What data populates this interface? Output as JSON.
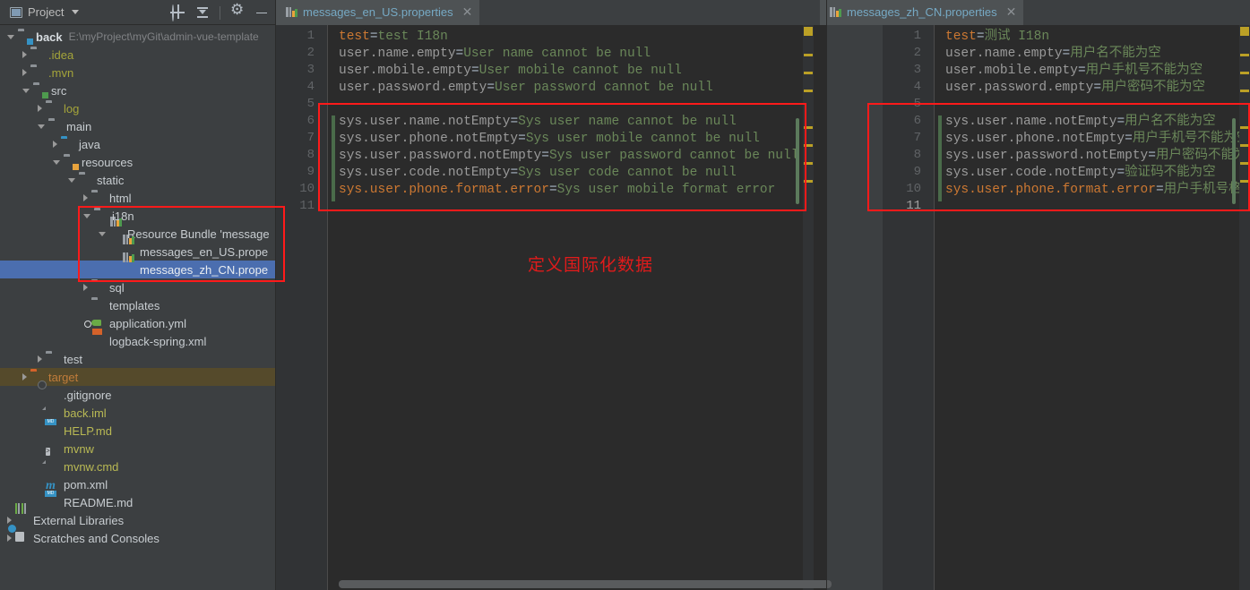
{
  "project_panel": {
    "title": "Project",
    "title_icon": "project-window-icon",
    "dropdown_icon": "chevron-down-icon",
    "tools": [
      {
        "name": "locate-icon",
        "label": "Select Opened File"
      },
      {
        "name": "collapse-all-icon",
        "label": "Collapse All"
      },
      {
        "name": "gear-icon",
        "label": "Settings"
      },
      {
        "name": "minimize-icon",
        "label": "Hide"
      }
    ],
    "tree": [
      {
        "indent": 0,
        "arrow": "open",
        "icon": "module-folder-icon",
        "label": "back",
        "style": "bold",
        "suffix": "E:\\myProject\\myGit\\admin-vue-template"
      },
      {
        "indent": 1,
        "arrow": "closed",
        "icon": "folder-icon",
        "label": ".idea",
        "style": "yellow"
      },
      {
        "indent": 1,
        "arrow": "closed",
        "icon": "folder-icon",
        "label": ".mvn",
        "style": "yellow"
      },
      {
        "indent": 1,
        "arrow": "open",
        "icon": "source-folder-icon",
        "label": "src",
        "style": "white"
      },
      {
        "indent": 2,
        "arrow": "closed",
        "icon": "folder-icon",
        "label": "log",
        "style": "yellow"
      },
      {
        "indent": 2,
        "arrow": "open",
        "icon": "folder-icon",
        "label": "main",
        "style": "white"
      },
      {
        "indent": 3,
        "arrow": "closed",
        "icon": "java-source-folder-icon",
        "label": "java",
        "style": "white"
      },
      {
        "indent": 3,
        "arrow": "open",
        "icon": "resources-folder-icon",
        "label": "resources",
        "style": "white"
      },
      {
        "indent": 4,
        "arrow": "open",
        "icon": "folder-icon",
        "label": "static",
        "style": "white"
      },
      {
        "indent": 5,
        "arrow": "closed",
        "icon": "folder-icon",
        "label": "html",
        "style": "white"
      },
      {
        "indent": 5,
        "arrow": "open",
        "icon": "folder-icon",
        "label": "i18n",
        "style": "white"
      },
      {
        "indent": 6,
        "arrow": "open",
        "icon": "resource-bundle-icon",
        "label": "Resource Bundle 'message",
        "style": "white"
      },
      {
        "indent": 7,
        "arrow": "none",
        "icon": "properties-file-icon",
        "label": "messages_en_US.prope",
        "style": "white"
      },
      {
        "indent": 7,
        "arrow": "none",
        "icon": "properties-file-icon",
        "label": "messages_zh_CN.prope",
        "style": "selected",
        "selected": true
      },
      {
        "indent": 5,
        "arrow": "closed",
        "icon": "folder-icon",
        "label": "sql",
        "style": "white"
      },
      {
        "indent": 5,
        "arrow": "none",
        "icon": "folder-icon",
        "label": "templates",
        "style": "white"
      },
      {
        "indent": 5,
        "arrow": "none",
        "icon": "yaml-file-icon",
        "label": "application.yml",
        "style": "white"
      },
      {
        "indent": 5,
        "arrow": "none",
        "icon": "xml-file-icon",
        "label": "logback-spring.xml",
        "style": "white"
      },
      {
        "indent": 2,
        "arrow": "closed",
        "icon": "folder-icon",
        "label": "test",
        "style": "white"
      },
      {
        "indent": 1,
        "arrow": "closed",
        "icon": "target-folder-icon",
        "label": "target",
        "style": "orange",
        "highlight": "target"
      },
      {
        "indent": 2,
        "arrow": "none",
        "icon": "gitignore-file-icon",
        "label": ".gitignore",
        "style": "white"
      },
      {
        "indent": 2,
        "arrow": "none",
        "icon": "iml-file-icon",
        "label": "back.iml",
        "style": "olive"
      },
      {
        "indent": 2,
        "arrow": "none",
        "icon": "markdown-file-icon",
        "label": "HELP.md",
        "style": "olive"
      },
      {
        "indent": 2,
        "arrow": "none",
        "icon": "shell-file-icon",
        "label": "mvnw",
        "style": "olive"
      },
      {
        "indent": 2,
        "arrow": "none",
        "icon": "cmd-file-icon",
        "label": "mvnw.cmd",
        "style": "olive"
      },
      {
        "indent": 2,
        "arrow": "none",
        "icon": "maven-file-icon",
        "label": "pom.xml",
        "style": "white"
      },
      {
        "indent": 2,
        "arrow": "none",
        "icon": "markdown-file-icon",
        "label": "README.md",
        "style": "white"
      },
      {
        "indent": 0,
        "arrow": "closed",
        "icon": "external-libraries-icon",
        "label": "External Libraries",
        "style": "white"
      },
      {
        "indent": 0,
        "arrow": "closed",
        "icon": "scratches-icon",
        "label": "Scratches and Consoles",
        "style": "white"
      }
    ]
  },
  "editors": {
    "left_tab": {
      "label": "messages_en_US.properties",
      "icon": "properties-file-icon",
      "close_icon": "close-icon"
    },
    "right_tab": {
      "label": "messages_zh_CN.properties",
      "icon": "properties-file-icon",
      "close_icon": "close-icon"
    },
    "left_file": {
      "line_numbers": [
        "1",
        "2",
        "3",
        "4",
        "5",
        "6",
        "7",
        "8",
        "9",
        "10",
        "11"
      ],
      "lines": [
        {
          "n": 1,
          "key": "test",
          "sep": "=",
          "value": "test I18n",
          "key_color": "orange"
        },
        {
          "n": 2,
          "key": "user.name.empty",
          "sep": "=",
          "value": "User name cannot be null",
          "key_color": "grey"
        },
        {
          "n": 3,
          "key": "user.mobile.empty",
          "sep": "=",
          "value": "User mobile cannot be null",
          "key_color": "grey"
        },
        {
          "n": 4,
          "key": "user.password.empty",
          "sep": "=",
          "value": "User password cannot be null",
          "key_color": "grey"
        },
        {
          "n": 5,
          "key": "",
          "sep": "",
          "value": "",
          "key_color": "grey"
        },
        {
          "n": 6,
          "key": "sys.user.name.notEmpty",
          "sep": "=",
          "value": "Sys user name cannot be null",
          "key_color": "grey"
        },
        {
          "n": 7,
          "key": "sys.user.phone.notEmpty",
          "sep": "=",
          "value": "Sys user mobile cannot be null",
          "key_color": "grey"
        },
        {
          "n": 8,
          "key": "sys.user.password.notEmpty",
          "sep": "=",
          "value": "Sys user password cannot be null",
          "key_color": "grey"
        },
        {
          "n": 9,
          "key": "sys.user.code.notEmpty",
          "sep": "=",
          "value": "Sys user code cannot be null",
          "key_color": "grey"
        },
        {
          "n": 10,
          "key": "sys.user.phone.format.error",
          "sep": "=",
          "value": "Sys user mobile format error",
          "key_color": "orange"
        },
        {
          "n": 11,
          "key": "",
          "sep": "",
          "value": "",
          "key_color": "grey"
        }
      ]
    },
    "right_file": {
      "line_numbers": [
        "1",
        "2",
        "3",
        "4",
        "5",
        "6",
        "7",
        "8",
        "9",
        "10",
        "11"
      ],
      "current_line": 11,
      "lines": [
        {
          "n": 1,
          "key": "test",
          "sep": "=",
          "value": "测试 I18n",
          "key_color": "orange"
        },
        {
          "n": 2,
          "key": "user.name.empty",
          "sep": "=",
          "value": "用户名不能为空",
          "key_color": "grey"
        },
        {
          "n": 3,
          "key": "user.mobile.empty",
          "sep": "=",
          "value": "用户手机号不能为空",
          "key_color": "grey"
        },
        {
          "n": 4,
          "key": "user.password.empty",
          "sep": "=",
          "value": "用户密码不能为空",
          "key_color": "grey"
        },
        {
          "n": 5,
          "key": "",
          "sep": "",
          "value": "",
          "key_color": "grey"
        },
        {
          "n": 6,
          "key": "sys.user.name.notEmpty",
          "sep": "=",
          "value": "用户名不能为空",
          "key_color": "grey"
        },
        {
          "n": 7,
          "key": "sys.user.phone.notEmpty",
          "sep": "=",
          "value": "用户手机号不能为空",
          "key_color": "grey"
        },
        {
          "n": 8,
          "key": "sys.user.password.notEmpty",
          "sep": "=",
          "value": "用户密码不能为空",
          "key_color": "grey"
        },
        {
          "n": 9,
          "key": "sys.user.code.notEmpty",
          "sep": "=",
          "value": "验证码不能为空",
          "key_color": "grey"
        },
        {
          "n": 10,
          "key": "sys.user.phone.format.error",
          "sep": "=",
          "value": "用户手机号格式错误",
          "key_color": "orange"
        },
        {
          "n": 11,
          "key": "",
          "sep": "",
          "value": "",
          "key_color": "grey"
        }
      ]
    }
  },
  "annotations": {
    "note_text": "定义国际化数据",
    "note_color": "#e01b1b",
    "box_color": "#ff1a1a"
  }
}
